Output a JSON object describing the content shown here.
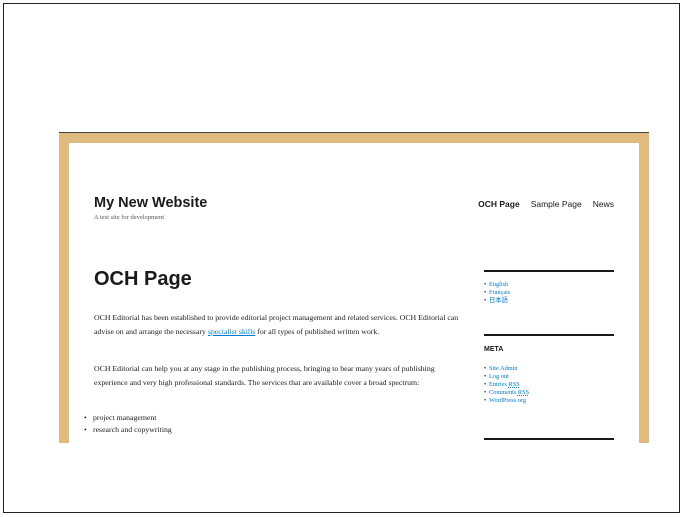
{
  "site": {
    "title": "My New Website",
    "tagline": "A test site for development"
  },
  "nav": {
    "items": [
      {
        "label": "OCH Page",
        "active": true
      },
      {
        "label": "Sample Page",
        "active": false
      },
      {
        "label": "News",
        "active": false
      }
    ]
  },
  "content": {
    "title": "OCH Page",
    "p1_before": "OCH Editorial has been established to provide editorial project management and related services. OCH Editorial can advise on and arrange the necessary ",
    "p1_link": "specialist skills",
    "p1_after": " for all types of published written work.",
    "p2": "OCH Editorial can help you at any stage in the publishing process, bringing to bear many years of publishing experience and very high professional standards. The services that are available cover a broad spectrum:",
    "list": [
      "project management",
      "research and copywriting"
    ]
  },
  "sidebar": {
    "languages": [
      "English",
      "Français",
      "日本語"
    ],
    "meta_title": "META",
    "meta": {
      "site_admin": "Site Admin",
      "log_out": "Log out",
      "entries": "Entries",
      "comments": "Comments",
      "rss": "RSS",
      "wordpress": "WordPress.org"
    }
  },
  "colors": {
    "border": "#e0bb80",
    "link": "#007acc",
    "text": "#1a1a1a"
  }
}
